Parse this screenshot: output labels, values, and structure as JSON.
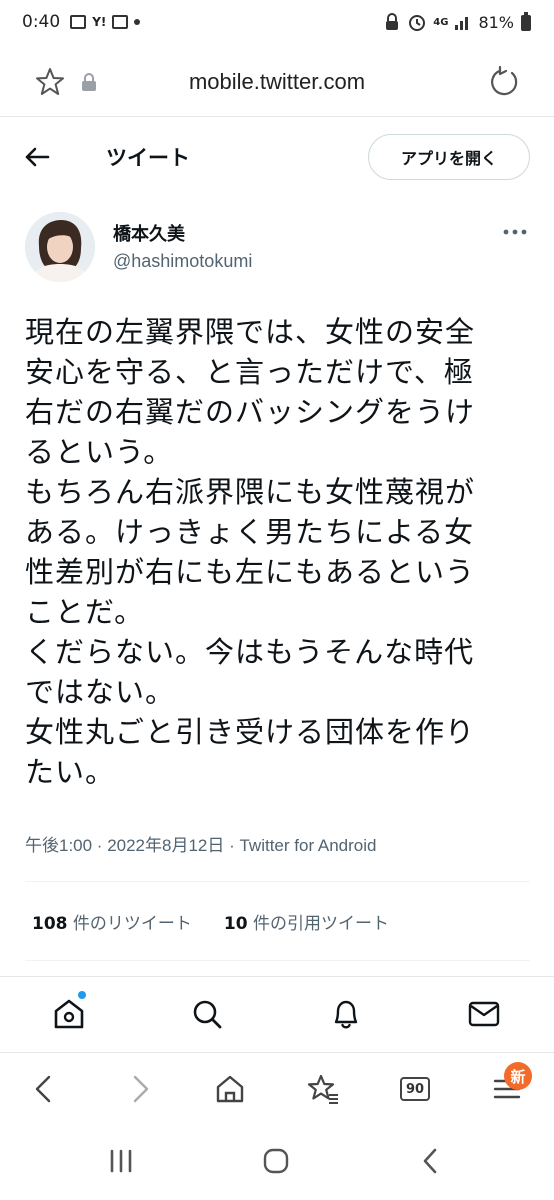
{
  "status_bar": {
    "time": "0:40",
    "network": "4G",
    "battery": "81%"
  },
  "browser": {
    "url": "mobile.twitter.com"
  },
  "header": {
    "title": "ツイート",
    "open_app_label": "アプリを開く"
  },
  "author": {
    "name": "橋本久美",
    "handle": "@hashimotokumi"
  },
  "tweet": {
    "lines": [
      "現在の左翼界隈では、女性の安全",
      "安心を守る、と言っただけで、極",
      "右だの右翼だのバッシングをうけ",
      "るという。",
      "もちろん右派界隈にも女性蔑視が",
      "ある。けっきょく男たちによる女",
      "性差別が右にも左にもあるという",
      "ことだ。",
      "くだらない。今はもうそんな時代",
      "ではない。",
      "女性丸ごと引き受ける団体を作り",
      "たい。"
    ],
    "meta": "午後1:00 · 2022年8月12日 · Twitter for Android"
  },
  "stats": {
    "retweets_count": "108",
    "retweets_label": "件のリツイート",
    "quotes_count": "10",
    "quotes_label": "件の引用ツイート"
  },
  "browser_nav": {
    "tabs_count": "90",
    "menu_badge": "新"
  },
  "colors": {
    "accent": "#1d9bf0",
    "text": "#0f1419",
    "secondary_text": "#536471",
    "badge": "#f26b2a"
  }
}
